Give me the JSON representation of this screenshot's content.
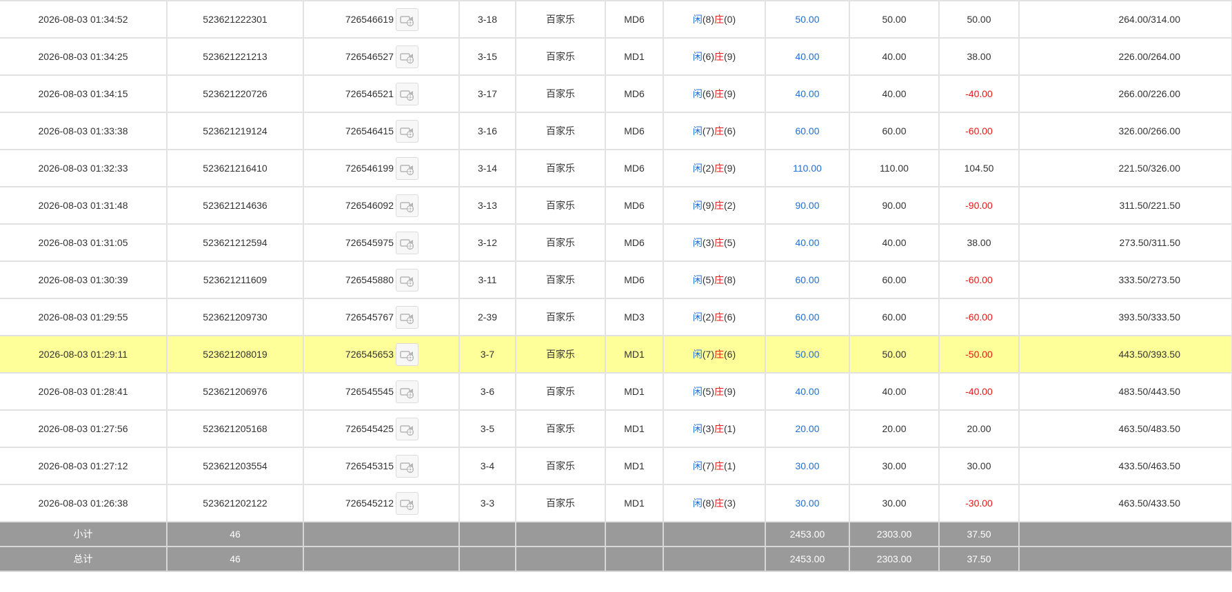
{
  "colors": {
    "blue": "#1f6fd8",
    "red": "#f01414",
    "highlight": "#ffff99",
    "footer_bg": "#9a9a9a"
  },
  "icon": "video-replay-icon",
  "rows": [
    {
      "time": "2026-08-03 01:34:52",
      "bet_id": "523621222301",
      "table_id": "726546619",
      "round": "3-18",
      "game": "百家乐",
      "table": "MD6",
      "player_label": "闲",
      "player_score": "(8)",
      "banker_label": "庄",
      "banker_score": "(0)",
      "bet": "50.00",
      "valid_bet": "50.00",
      "win_loss": "50.00",
      "win_loss_color": "normal",
      "balance": "264.00/314.00",
      "highlighted": false
    },
    {
      "time": "2026-08-03 01:34:25",
      "bet_id": "523621221213",
      "table_id": "726546527",
      "round": "3-15",
      "game": "百家乐",
      "table": "MD1",
      "player_label": "闲",
      "player_score": "(6)",
      "banker_label": "庄",
      "banker_score": "(9)",
      "bet": "40.00",
      "valid_bet": "40.00",
      "win_loss": "38.00",
      "win_loss_color": "normal",
      "balance": "226.00/264.00",
      "highlighted": false
    },
    {
      "time": "2026-08-03 01:34:15",
      "bet_id": "523621220726",
      "table_id": "726546521",
      "round": "3-17",
      "game": "百家乐",
      "table": "MD6",
      "player_label": "闲",
      "player_score": "(6)",
      "banker_label": "庄",
      "banker_score": "(9)",
      "bet": "40.00",
      "valid_bet": "40.00",
      "win_loss": "-40.00",
      "win_loss_color": "red",
      "balance": "266.00/226.00",
      "highlighted": false
    },
    {
      "time": "2026-08-03 01:33:38",
      "bet_id": "523621219124",
      "table_id": "726546415",
      "round": "3-16",
      "game": "百家乐",
      "table": "MD6",
      "player_label": "闲",
      "player_score": "(7)",
      "banker_label": "庄",
      "banker_score": "(6)",
      "bet": "60.00",
      "valid_bet": "60.00",
      "win_loss": "-60.00",
      "win_loss_color": "red",
      "balance": "326.00/266.00",
      "highlighted": false
    },
    {
      "time": "2026-08-03 01:32:33",
      "bet_id": "523621216410",
      "table_id": "726546199",
      "round": "3-14",
      "game": "百家乐",
      "table": "MD6",
      "player_label": "闲",
      "player_score": "(2)",
      "banker_label": "庄",
      "banker_score": "(9)",
      "bet": "110.00",
      "valid_bet": "110.00",
      "win_loss": "104.50",
      "win_loss_color": "normal",
      "balance": "221.50/326.00",
      "highlighted": false
    },
    {
      "time": "2026-08-03 01:31:48",
      "bet_id": "523621214636",
      "table_id": "726546092",
      "round": "3-13",
      "game": "百家乐",
      "table": "MD6",
      "player_label": "闲",
      "player_score": "(9)",
      "banker_label": "庄",
      "banker_score": "(2)",
      "bet": "90.00",
      "valid_bet": "90.00",
      "win_loss": "-90.00",
      "win_loss_color": "red",
      "balance": "311.50/221.50",
      "highlighted": false
    },
    {
      "time": "2026-08-03 01:31:05",
      "bet_id": "523621212594",
      "table_id": "726545975",
      "round": "3-12",
      "game": "百家乐",
      "table": "MD6",
      "player_label": "闲",
      "player_score": "(3)",
      "banker_label": "庄",
      "banker_score": "(5)",
      "bet": "40.00",
      "valid_bet": "40.00",
      "win_loss": "38.00",
      "win_loss_color": "normal",
      "balance": "273.50/311.50",
      "highlighted": false
    },
    {
      "time": "2026-08-03 01:30:39",
      "bet_id": "523621211609",
      "table_id": "726545880",
      "round": "3-11",
      "game": "百家乐",
      "table": "MD6",
      "player_label": "闲",
      "player_score": "(5)",
      "banker_label": "庄",
      "banker_score": "(8)",
      "bet": "60.00",
      "valid_bet": "60.00",
      "win_loss": "-60.00",
      "win_loss_color": "red",
      "balance": "333.50/273.50",
      "highlighted": false
    },
    {
      "time": "2026-08-03 01:29:55",
      "bet_id": "523621209730",
      "table_id": "726545767",
      "round": "2-39",
      "game": "百家乐",
      "table": "MD3",
      "player_label": "闲",
      "player_score": "(2)",
      "banker_label": "庄",
      "banker_score": "(6)",
      "bet": "60.00",
      "valid_bet": "60.00",
      "win_loss": "-60.00",
      "win_loss_color": "red",
      "balance": "393.50/333.50",
      "highlighted": false
    },
    {
      "time": "2026-08-03 01:29:11",
      "bet_id": "523621208019",
      "table_id": "726545653",
      "round": "3-7",
      "game": "百家乐",
      "table": "MD1",
      "player_label": "闲",
      "player_score": "(7)",
      "banker_label": "庄",
      "banker_score": "(6)",
      "bet": "50.00",
      "valid_bet": "50.00",
      "win_loss": "-50.00",
      "win_loss_color": "red",
      "balance": "443.50/393.50",
      "highlighted": true
    },
    {
      "time": "2026-08-03 01:28:41",
      "bet_id": "523621206976",
      "table_id": "726545545",
      "round": "3-6",
      "game": "百家乐",
      "table": "MD1",
      "player_label": "闲",
      "player_score": "(5)",
      "banker_label": "庄",
      "banker_score": "(9)",
      "bet": "40.00",
      "valid_bet": "40.00",
      "win_loss": "-40.00",
      "win_loss_color": "red",
      "balance": "483.50/443.50",
      "highlighted": false
    },
    {
      "time": "2026-08-03 01:27:56",
      "bet_id": "523621205168",
      "table_id": "726545425",
      "round": "3-5",
      "game": "百家乐",
      "table": "MD1",
      "player_label": "闲",
      "player_score": "(3)",
      "banker_label": "庄",
      "banker_score": "(1)",
      "bet": "20.00",
      "valid_bet": "20.00",
      "win_loss": "20.00",
      "win_loss_color": "normal",
      "balance": "463.50/483.50",
      "highlighted": false
    },
    {
      "time": "2026-08-03 01:27:12",
      "bet_id": "523621203554",
      "table_id": "726545315",
      "round": "3-4",
      "game": "百家乐",
      "table": "MD1",
      "player_label": "闲",
      "player_score": "(7)",
      "banker_label": "庄",
      "banker_score": "(1)",
      "bet": "30.00",
      "valid_bet": "30.00",
      "win_loss": "30.00",
      "win_loss_color": "normal",
      "balance": "433.50/463.50",
      "highlighted": false
    },
    {
      "time": "2026-08-03 01:26:38",
      "bet_id": "523621202122",
      "table_id": "726545212",
      "round": "3-3",
      "game": "百家乐",
      "table": "MD1",
      "player_label": "闲",
      "player_score": "(8)",
      "banker_label": "庄",
      "banker_score": "(3)",
      "bet": "30.00",
      "valid_bet": "30.00",
      "win_loss": "-30.00",
      "win_loss_color": "red",
      "balance": "463.50/433.50",
      "highlighted": false
    }
  ],
  "subtotal": {
    "label": "小计",
    "count": "46",
    "bet": "2453.00",
    "valid_bet": "2303.00",
    "win_loss": "37.50"
  },
  "total": {
    "label": "总计",
    "count": "46",
    "bet": "2453.00",
    "valid_bet": "2303.00",
    "win_loss": "37.50"
  }
}
